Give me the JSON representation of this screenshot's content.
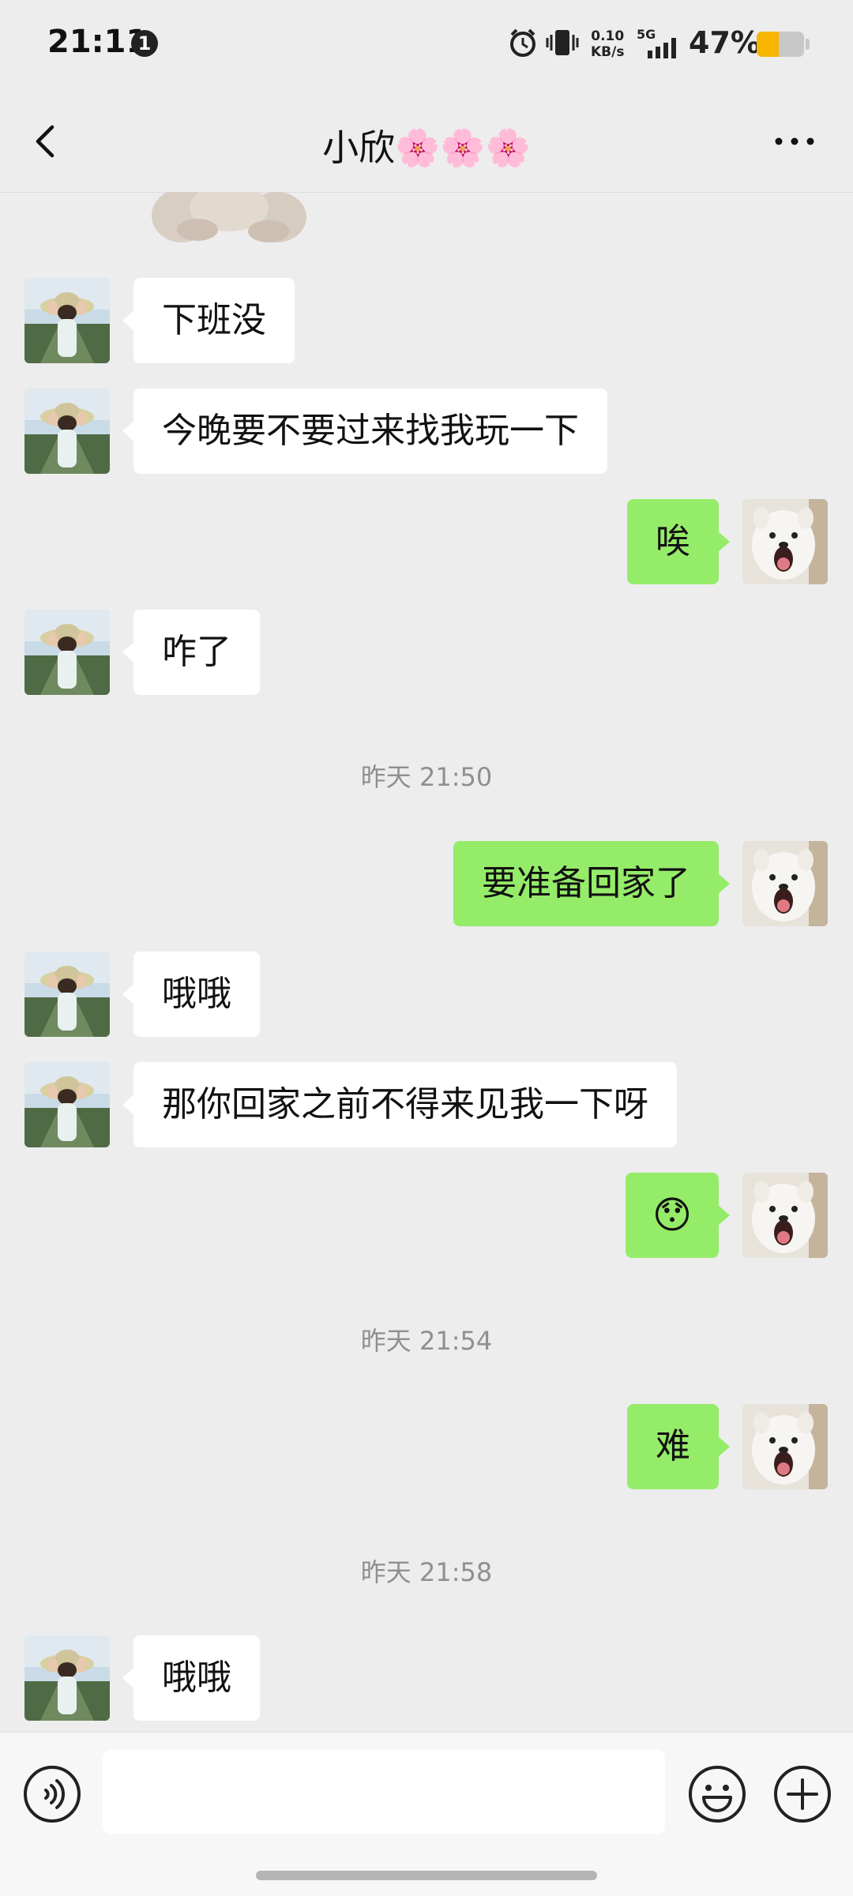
{
  "status_bar": {
    "time": "21:11",
    "notification_count": "1",
    "net_speed_value": "0.10",
    "net_speed_unit": "KB/s",
    "network_type": "5G",
    "battery_percent": "47%",
    "battery_level": 0.47,
    "icons": [
      "alarm-icon",
      "vibrate-icon",
      "signal-icon",
      "battery-icon"
    ]
  },
  "header": {
    "title": "小欣🌸🌸🌸",
    "back_icon": "chevron-left-icon",
    "more_icon": "more-dots-icon"
  },
  "messages": [
    {
      "type": "sticker",
      "from": "contact",
      "description": "bear sticker (partially visible)"
    },
    {
      "type": "text",
      "from": "contact",
      "text": "下班没"
    },
    {
      "type": "text",
      "from": "contact",
      "text": "今晚要不要过来找我玩一下"
    },
    {
      "type": "text",
      "from": "me",
      "text": "唉"
    },
    {
      "type": "text",
      "from": "contact",
      "text": "咋了"
    },
    {
      "type": "time",
      "text": "昨天 21:50"
    },
    {
      "type": "text",
      "from": "me",
      "text": "要准备回家了"
    },
    {
      "type": "text",
      "from": "contact",
      "text": "哦哦"
    },
    {
      "type": "text",
      "from": "contact",
      "text": "那你回家之前不得来见我一下呀"
    },
    {
      "type": "emoji",
      "from": "me",
      "text": "😯"
    },
    {
      "type": "time",
      "text": "昨天 21:54"
    },
    {
      "type": "text",
      "from": "me",
      "text": "难"
    },
    {
      "type": "time",
      "text": "昨天 21:58"
    },
    {
      "type": "text",
      "from": "contact",
      "text": "哦哦"
    }
  ],
  "input_bar": {
    "voice_icon": "voice-icon",
    "text_value": "",
    "emoji_icon": "emoji-icon",
    "plus_icon": "plus-icon"
  },
  "colors": {
    "background": "#ededed",
    "bubble_me": "#95ec69",
    "bubble_contact": "#ffffff",
    "timestamp": "#8f8f8f",
    "battery_fill": "#f7b500"
  }
}
